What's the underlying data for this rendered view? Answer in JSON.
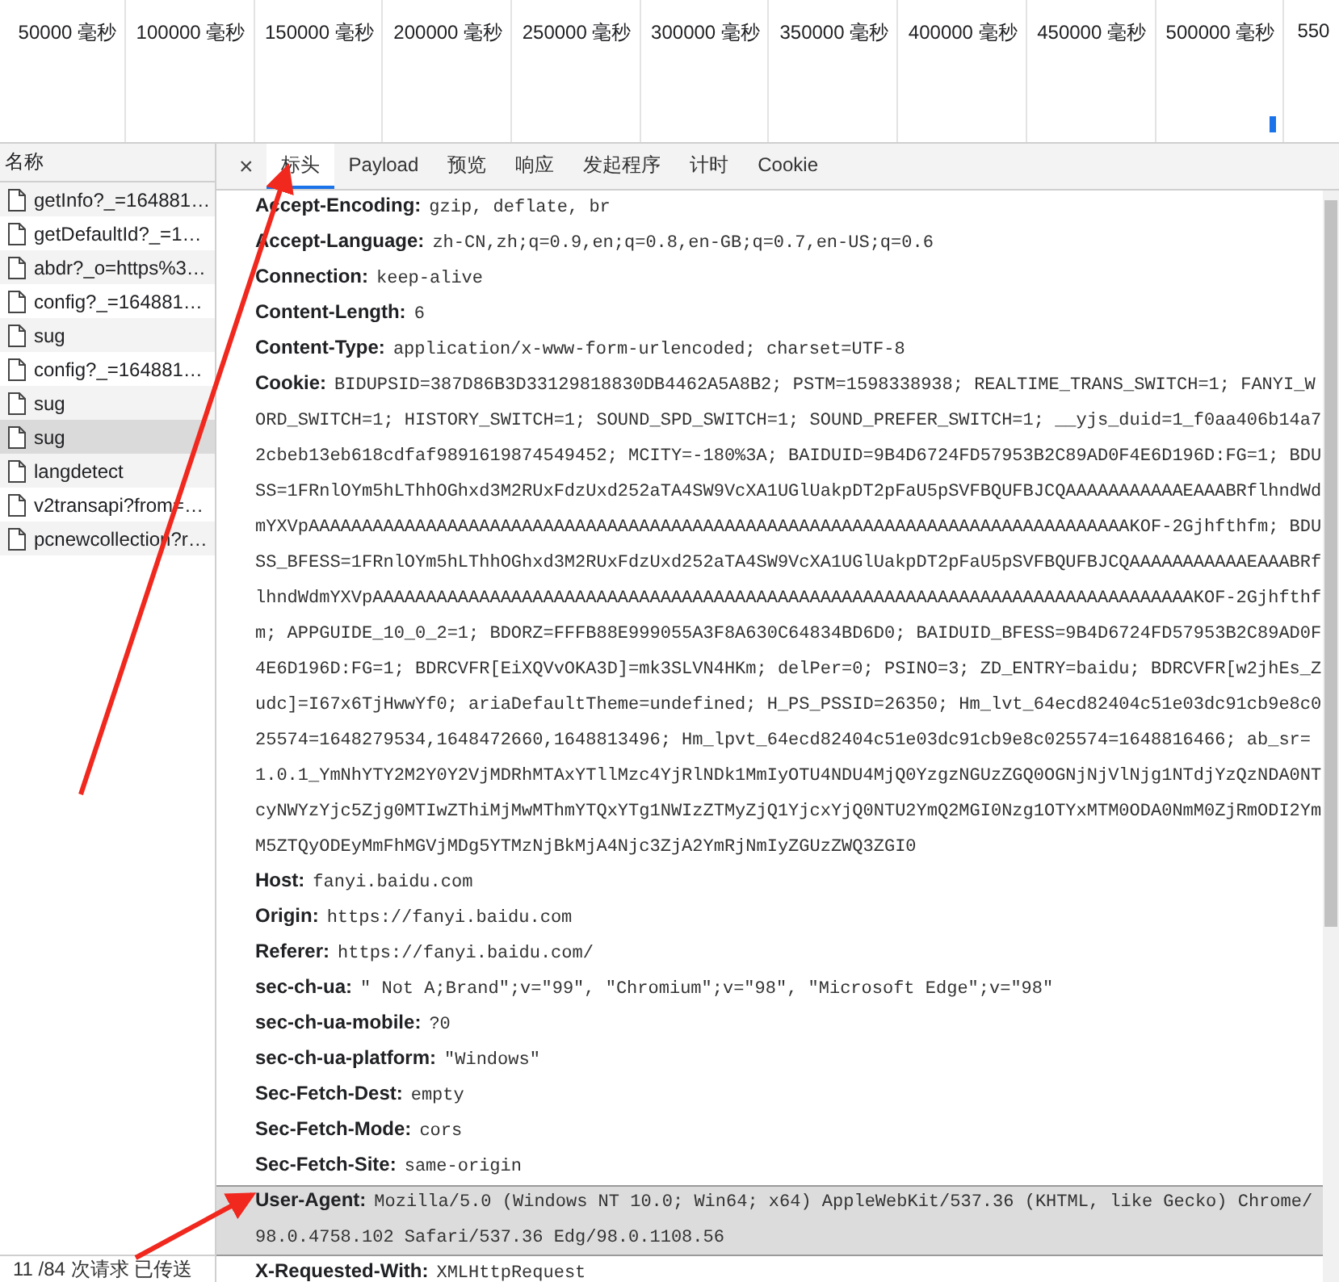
{
  "timeline": {
    "ticks": [
      "50000 毫秒",
      "100000 毫秒",
      "150000 毫秒",
      "200000 毫秒",
      "250000 毫秒",
      "300000 毫秒",
      "350000 毫秒",
      "400000 毫秒",
      "450000 毫秒",
      "500000 毫秒",
      "550"
    ]
  },
  "requests": {
    "header": "名称",
    "items": [
      {
        "name": "getInfo?_=164881…",
        "selected": false
      },
      {
        "name": "getDefaultId?_=1…",
        "selected": false
      },
      {
        "name": "abdr?_o=https%3…",
        "selected": false
      },
      {
        "name": "config?_=164881…",
        "selected": false
      },
      {
        "name": "sug",
        "selected": false
      },
      {
        "name": "config?_=164881…",
        "selected": false
      },
      {
        "name": "sug",
        "selected": false
      },
      {
        "name": "sug",
        "selected": true
      },
      {
        "name": "langdetect",
        "selected": false
      },
      {
        "name": "v2transapi?from=…",
        "selected": false
      },
      {
        "name": "pcnewcollection?r…",
        "selected": false
      }
    ],
    "status": "11 /84 次请求  已传送"
  },
  "details": {
    "close": "×",
    "tabs": [
      {
        "label": "标头",
        "selected": true
      },
      {
        "label": "Payload",
        "selected": false
      },
      {
        "label": "预览",
        "selected": false
      },
      {
        "label": "响应",
        "selected": false
      },
      {
        "label": "发起程序",
        "selected": false
      },
      {
        "label": "计时",
        "selected": false
      },
      {
        "label": "Cookie",
        "selected": false
      }
    ],
    "headers": [
      {
        "name": "Accept-Encoding:",
        "value": "gzip, deflate, br",
        "selected": false
      },
      {
        "name": "Accept-Language:",
        "value": "zh-CN,zh;q=0.9,en;q=0.8,en-GB;q=0.7,en-US;q=0.6",
        "selected": false
      },
      {
        "name": "Connection:",
        "value": "keep-alive",
        "selected": false
      },
      {
        "name": "Content-Length:",
        "value": "6",
        "selected": false
      },
      {
        "name": "Content-Type:",
        "value": "application/x-www-form-urlencoded; charset=UTF-8",
        "selected": false
      },
      {
        "name": "Cookie:",
        "value": "BIDUPSID=387D86B3D33129818830DB4462A5A8B2; PSTM=1598338938; REALTIME_TRANS_SWITCH=1; FANYI_WORD_SWITCH=1; HISTORY_SWITCH=1; SOUND_SPD_SWITCH=1; SOUND_PREFER_SWITCH=1; __yjs_duid=1_f0aa406b14a72cbeb13eb618cdfaf9891619874549452; MCITY=-180%3A; BAIDUID=9B4D6724FD57953B2C89AD0F4E6D196D:FG=1; BDUSS=1FRnlOYm5hLThhOGhxd3M2RUxFdzUxd252aTA4SW9VcXA1UGlUakpDT2pFaU5pSVFBQUFBJCQAAAAAAAAAAAEAAABRflhndWdmYXVpAAAAAAAAAAAAAAAAAAAAAAAAAAAAAAAAAAAAAAAAAAAAAAAAAAAAAAAAAAAAAAAAAAAAAAAAAAAAAKOF-2Gjhfthfm; BDUSS_BFESS=1FRnlOYm5hLThhOGhxd3M2RUxFdzUxd252aTA4SW9VcXA1UGlUakpDT2pFaU5pSVFBQUFBJCQAAAAAAAAAAAEAAABRflhndWdmYXVpAAAAAAAAAAAAAAAAAAAAAAAAAAAAAAAAAAAAAAAAAAAAAAAAAAAAAAAAAAAAAAAAAAAAAAAAAAAAAKOF-2Gjhfthfm; APPGUIDE_10_0_2=1; BDORZ=FFFB88E999055A3F8A630C64834BD6D0; BAIDUID_BFESS=9B4D6724FD57953B2C89AD0F4E6D196D:FG=1; BDRCVFR[EiXQVvOKA3D]=mk3SLVN4HKm; delPer=0; PSINO=3; ZD_ENTRY=baidu; BDRCVFR[w2jhEs_Zudc]=I67x6TjHwwYf0; ariaDefaultTheme=undefined; H_PS_PSSID=26350; Hm_lvt_64ecd82404c51e03dc91cb9e8c025574=1648279534,1648472660,1648813496; Hm_lpvt_64ecd82404c51e03dc91cb9e8c025574=1648816466; ab_sr=1.0.1_YmNhYTY2M2Y0Y2VjMDRhMTAxYTllMzc4YjRlNDk1MmIyOTU4NDU4MjQ0YzgzNGUzZGQ0OGNjNjVlNjg1NTdjYzQzNDA0NTcyNWYzYjc5Zjg0MTIwZThiMjMwMThmYTQxYTg1NWIzZTMyZjQ1YjcxYjQ0NTU2YmQ2MGI0Nzg1OTYxMTM0ODA0NmM0ZjRmODI2YmM5ZTQyODEyMmFhMGVjMDg5YTMzNjBkMjA4Njc3ZjA2YmRjNmIyZGUzZWQ3ZGI0",
        "selected": false
      },
      {
        "name": "Host:",
        "value": "fanyi.baidu.com",
        "selected": false
      },
      {
        "name": "Origin:",
        "value": "https://fanyi.baidu.com",
        "selected": false
      },
      {
        "name": "Referer:",
        "value": "https://fanyi.baidu.com/",
        "selected": false
      },
      {
        "name": "sec-ch-ua:",
        "value": "\" Not A;Brand\";v=\"99\", \"Chromium\";v=\"98\", \"Microsoft Edge\";v=\"98\"",
        "selected": false
      },
      {
        "name": "sec-ch-ua-mobile:",
        "value": "?0",
        "selected": false
      },
      {
        "name": "sec-ch-ua-platform:",
        "value": "\"Windows\"",
        "selected": false
      },
      {
        "name": "Sec-Fetch-Dest:",
        "value": "empty",
        "selected": false
      },
      {
        "name": "Sec-Fetch-Mode:",
        "value": "cors",
        "selected": false
      },
      {
        "name": "Sec-Fetch-Site:",
        "value": "same-origin",
        "selected": false
      },
      {
        "name": "User-Agent:",
        "value": "Mozilla/5.0 (Windows NT 10.0; Win64; x64) AppleWebKit/537.36 (KHTML, like Gecko) Chrome/98.0.4758.102 Safari/537.36 Edg/98.0.1108.56",
        "selected": true
      },
      {
        "name": "X-Requested-With:",
        "value": "XMLHttpRequest",
        "selected": false
      }
    ]
  }
}
